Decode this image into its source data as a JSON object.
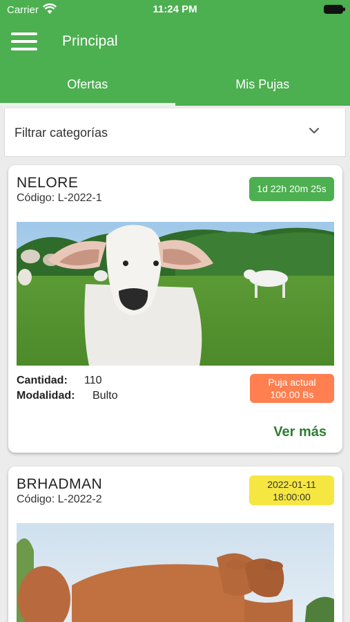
{
  "status_bar": {
    "carrier": "Carrier",
    "time": "11:24 PM"
  },
  "app_bar": {
    "title": "Principal"
  },
  "tabs": [
    {
      "label": "Ofertas",
      "active": true
    },
    {
      "label": "Mis Pujas",
      "active": false
    }
  ],
  "filter": {
    "label": "Filtrar categorías"
  },
  "colors": {
    "primary": "#4caf50",
    "timer_badge": "#4caf50",
    "date_badge": "#f5e642",
    "bid_badge": "#ff7f50",
    "link": "#2e7d32"
  },
  "offers": [
    {
      "name": "NELORE",
      "code": "Código: L-2022-1",
      "badge": "1d 22h 20m 25s",
      "quantity_label": "Cantidad:",
      "quantity": "110",
      "modality_label": "Modalidad:",
      "modality": "Bulto",
      "bid_line1": "Puja actual",
      "bid_line2": "100.00 Bs",
      "more": "Ver más"
    },
    {
      "name": "BRHADMAN",
      "code": "Código: L-2022-2",
      "badge_line1": "2022-01-11",
      "badge_line2": "18:00:00"
    }
  ]
}
